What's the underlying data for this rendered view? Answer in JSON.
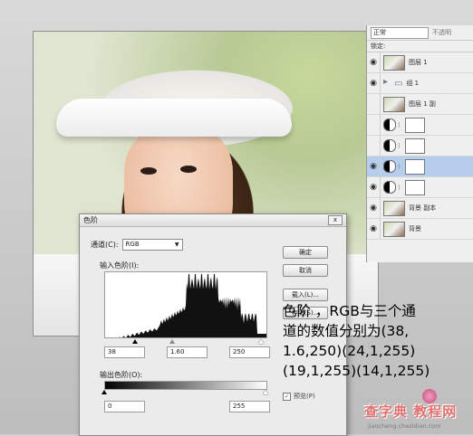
{
  "layers_panel": {
    "blend_mode": "正常",
    "opacity_label": "不透明",
    "lock_label": "锁定:",
    "layers": [
      {
        "name": "图层 1",
        "visible": true,
        "thumb": "photo",
        "selected": false
      },
      {
        "name": "组 1",
        "visible": true,
        "thumb": "folder",
        "selected": false
      },
      {
        "name": "图层 1 副",
        "visible": false,
        "thumb": "photo",
        "selected": false
      },
      {
        "name": "",
        "visible": false,
        "thumb": "adjustment",
        "selected": false
      },
      {
        "name": "",
        "visible": false,
        "thumb": "adjustment",
        "selected": false
      },
      {
        "name": "",
        "visible": true,
        "thumb": "adjustment",
        "selected": true
      },
      {
        "name": "",
        "visible": true,
        "thumb": "adjustment",
        "selected": false
      },
      {
        "name": "背景 副本",
        "visible": true,
        "thumb": "photo",
        "selected": false
      },
      {
        "name": "背景",
        "visible": true,
        "thumb": "photo",
        "selected": false
      }
    ]
  },
  "dialog": {
    "title": "色阶",
    "close_label": "x",
    "channel_label": "通道(C):",
    "channel_value": "RGB",
    "input_levels_label": "输入色阶(I):",
    "input_black": "38",
    "input_gamma": "1.60",
    "input_white": "250",
    "output_levels_label": "输出色阶(O):",
    "output_black": "0",
    "output_white": "255",
    "buttons": {
      "ok": "确定",
      "cancel": "取消",
      "load": "载入(L)...",
      "save": "存储(S)..."
    },
    "preview_label": "预览(P)",
    "preview_checked": true
  },
  "caption": {
    "lines": [
      "色阶 ，RGB与三个通",
      "道的数值分别为(38,",
      "1.6,250)(24,1,255)",
      "(19,1,255)(14,1,255)"
    ]
  },
  "watermark": {
    "text": "查字典 教程网",
    "url": "jiaocheng.chazidian.com"
  },
  "colors": {
    "selected_layer": "#b7cdee",
    "caption_text": "#000000",
    "watermark": "#e07070"
  }
}
